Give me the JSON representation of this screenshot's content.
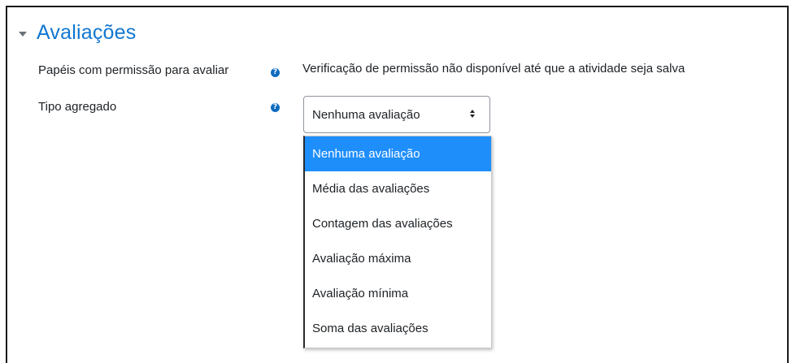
{
  "section": {
    "title": "Avaliações",
    "collapse_icon": "chevron-down-icon"
  },
  "rows": [
    {
      "label": "Papéis com permissão para avaliar",
      "help_icon": "question-circle-icon",
      "value": "Verificação de permissão não disponível até que a atividade seja salva"
    },
    {
      "label": "Tipo agregado",
      "help_icon": "question-circle-icon",
      "select_value": "Nenhuma avaliação"
    }
  ],
  "help_glyph": "?",
  "dropdown": {
    "options": [
      "Nenhuma avaliação",
      "Média das avaliações",
      "Contagem das avaliações",
      "Avaliação máxima",
      "Avaliação mínima",
      "Soma das avaliações"
    ],
    "selected_index": 0
  },
  "colors": {
    "accent": "#1177d1",
    "highlight": "#1e8efb",
    "help_icon": "#0f6cbf"
  }
}
